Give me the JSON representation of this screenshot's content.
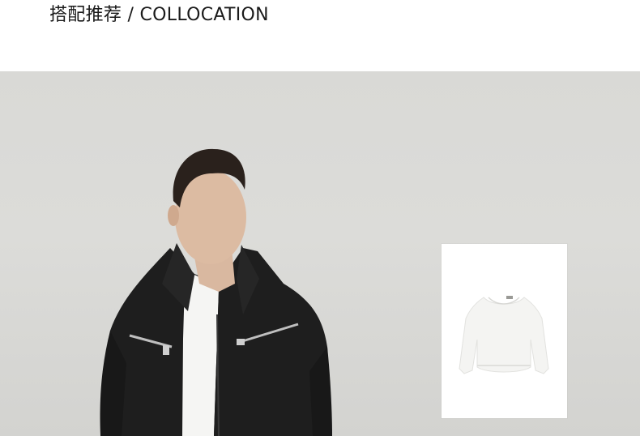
{
  "section": {
    "title": "搭配推荐 / COLLOCATION"
  },
  "hero": {
    "icon": "model-photo",
    "background_color": "#dadad7"
  },
  "product": {
    "icon": "white-sweatshirt-image",
    "card_background": "#ffffff"
  }
}
